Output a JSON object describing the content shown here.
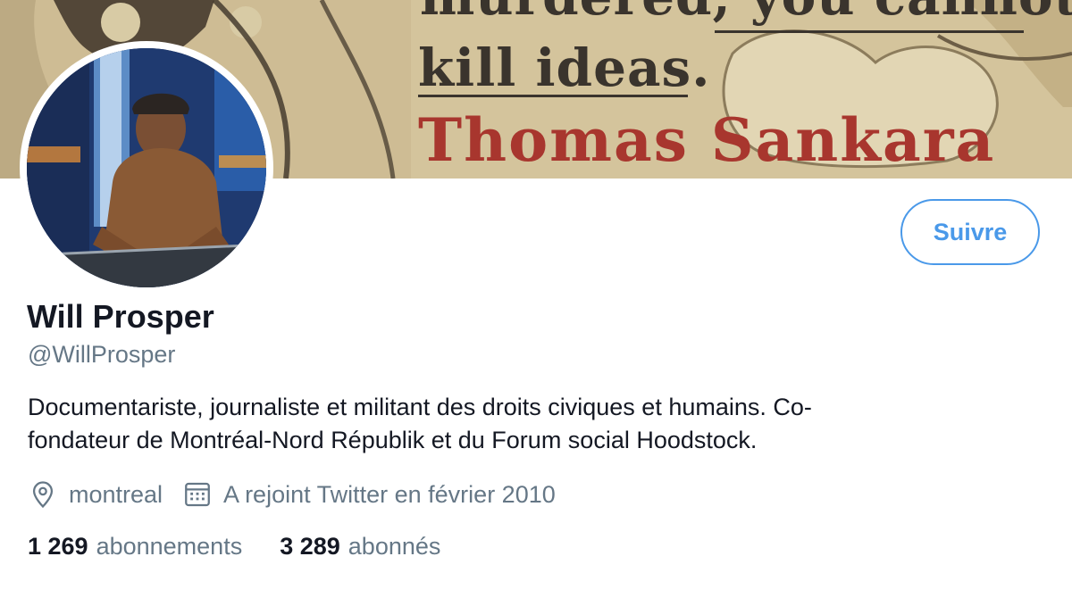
{
  "banner": {
    "line1": "murdered, you cannot",
    "line2": "kill ideas.",
    "line3": "Thomas Sankara"
  },
  "profile": {
    "display_name": "Will Prosper",
    "handle": "@WillProsper",
    "bio_line1": "Documentariste, journaliste et militant des droits civiques et humains. Co-",
    "bio_line2": "fondateur de Montréal-Nord Républik et du Forum social Hoodstock.",
    "location": "montreal",
    "joined": "A rejoint Twitter en février 2010"
  },
  "actions": {
    "follow_label": "Suivre"
  },
  "stats": {
    "following_count": "1 269",
    "following_label": "abonnements",
    "followers_count": "3 289",
    "followers_label": "abonnés"
  },
  "colors": {
    "accent": "#4a99e9",
    "secondary_text": "#657786",
    "primary_text": "#141823"
  },
  "icons": {
    "location": "location-pin-icon",
    "joined": "calendar-icon"
  }
}
